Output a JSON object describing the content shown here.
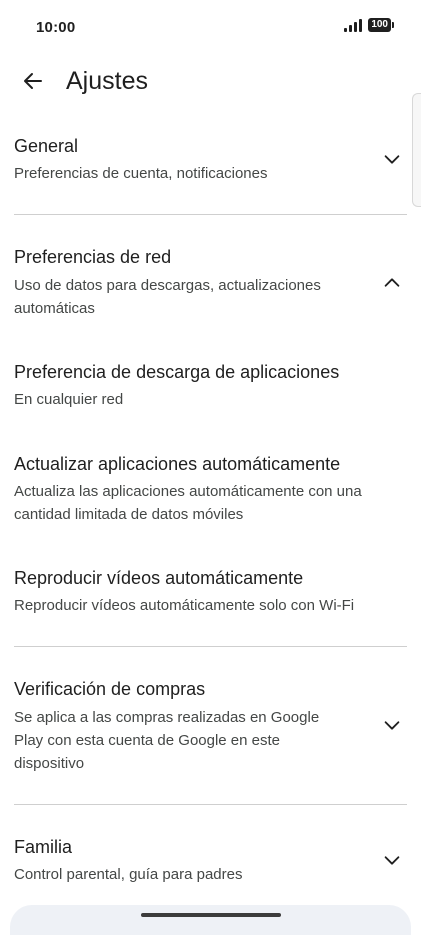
{
  "status_bar": {
    "time": "10:00",
    "battery": "100"
  },
  "header": {
    "title": "Ajustes"
  },
  "sections": {
    "general": {
      "title": "General",
      "subtitle": "Preferencias de cuenta, notificaciones"
    },
    "network": {
      "title": "Preferencias de red",
      "subtitle_line1": "Uso de datos para descargas, actualizaciones",
      "subtitle_line2": "automáticas",
      "items": {
        "download": {
          "title": "Preferencia de descarga de aplicaciones",
          "subtitle": "En cualquier red"
        },
        "auto_update": {
          "title": "Actualizar aplicaciones automáticamente",
          "subtitle_line1": "Actualiza las aplicaciones automáticamente con una",
          "subtitle_line2": "cantidad limitada de datos móviles"
        },
        "autoplay": {
          "title": "Reproducir vídeos automáticamente",
          "subtitle": "Reproducir vídeos automáticamente solo con Wi-Fi"
        }
      }
    },
    "purchase": {
      "title": "Verificación de compras",
      "subtitle_line1": "Se aplica a las compras realizadas en Google",
      "subtitle_line2": "Play con esta cuenta de Google en este",
      "subtitle_line3": "dispositivo"
    },
    "family": {
      "title": "Familia",
      "subtitle": "Control parental, guía para padres"
    }
  }
}
